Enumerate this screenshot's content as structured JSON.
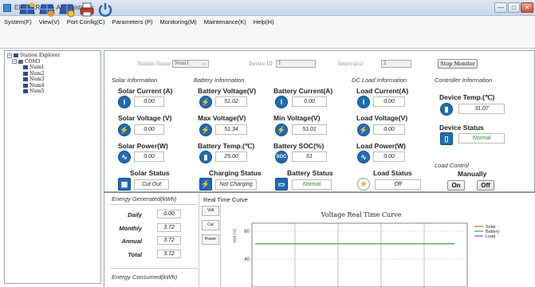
{
  "window": {
    "title": "EPEVER —— Administrator",
    "controls": [
      "—",
      "□",
      "✕"
    ]
  },
  "menu": [
    "System(F)",
    "View(V)",
    "Port Config(C)",
    "Parameters (P)",
    "Monitoring(M)",
    "Maintenance(K)",
    "Help(H)"
  ],
  "toolbar": {
    "icons": [
      "solar-panel-icon",
      "solar-panel-connect-icon",
      "solar-panel-settings-icon",
      "printer-icon",
      "power-icon"
    ]
  },
  "tree": {
    "root": "Station Explorer",
    "port": "COM3",
    "nodes": [
      "Num1",
      "Num2",
      "Num3",
      "Num4",
      "Num5"
    ]
  },
  "station_bar": {
    "station_name_label": "Station Name",
    "station_name_value": "Num1",
    "device_id_label": "Device ID",
    "device_id_value": "1",
    "interval_label": "Interval(s)",
    "interval_value": "2",
    "stop_monitor": "Stop Monitor"
  },
  "solar": {
    "title": "Solar Information",
    "current_label": "Solar Current (A)",
    "current_value": "0.00",
    "voltage_label": "Solar Voltage (V)",
    "voltage_value": "0.00",
    "power_label": "Solar Power(W)",
    "power_value": "0.00",
    "status_label": "Solar Status",
    "status_value": "Cut Out"
  },
  "battery": {
    "title": "Battery Information",
    "voltage_label": "Battery Voltage(V)",
    "voltage_value": "51.02",
    "current_label": "Battery Current(A)",
    "current_value": "0.00",
    "max_voltage_label": "Max Voltage(V)",
    "max_voltage_value": "51.34",
    "min_voltage_label": "Min Voltage(V)",
    "min_voltage_value": "51.01",
    "temp_label": "Battery Temp.(℃)",
    "temp_value": "25.00",
    "soc_label": "Battery SOC(%)",
    "soc_value": "61",
    "charging_status_label": "Charging Status",
    "charging_status_value": "Not Charging",
    "battery_status_label": "Battery Status",
    "battery_status_value": "Normal"
  },
  "load": {
    "title": "DC Load Information",
    "current_label": "Load Current(A)",
    "current_value": "0.00",
    "voltage_label": "Load Voltage(V)",
    "voltage_value": "0.00",
    "power_label": "Load Power(W)",
    "power_value": "0.00",
    "status_label": "Load Status",
    "status_value": "Off"
  },
  "controller": {
    "title": "Controller Information",
    "temp_label": "Device Temp.(℃)",
    "temp_value": "31.07",
    "status_label": "Device Status",
    "status_value": "Normal",
    "load_control_label": "Load Control",
    "manually_label": "Manually",
    "on_label": "On",
    "off_label": "Off"
  },
  "energy": {
    "generated_title": "Energy Generated(kWh)",
    "rows": [
      {
        "label": "Daily",
        "value": "0.00"
      },
      {
        "label": "Monthly",
        "value": "3.72"
      },
      {
        "label": "Annual",
        "value": "3.72"
      },
      {
        "label": "Total",
        "value": "3.72"
      }
    ],
    "consumed_title": "Energy Consumed(kWh)"
  },
  "realtime": {
    "title": "Real Time Curve",
    "tabs": [
      "Volt",
      "Cur",
      "Power"
    ]
  },
  "chart_data": {
    "type": "line",
    "title": "Voltage Real Time Curve",
    "ylabel": "Volt (V)",
    "ylim_visible": [
      40,
      60
    ],
    "y_ticks": [
      60,
      40
    ],
    "series": [
      {
        "name": "Solar",
        "color": "#e05a3a",
        "values": []
      },
      {
        "name": "Battery",
        "color": "#3aa84a",
        "values": [
          51.02,
          51.02,
          51.02,
          51.02,
          51.02,
          51.02
        ]
      },
      {
        "name": "Load",
        "color": "#5a5ae0",
        "values": []
      }
    ],
    "grid": true,
    "legend": "right"
  }
}
